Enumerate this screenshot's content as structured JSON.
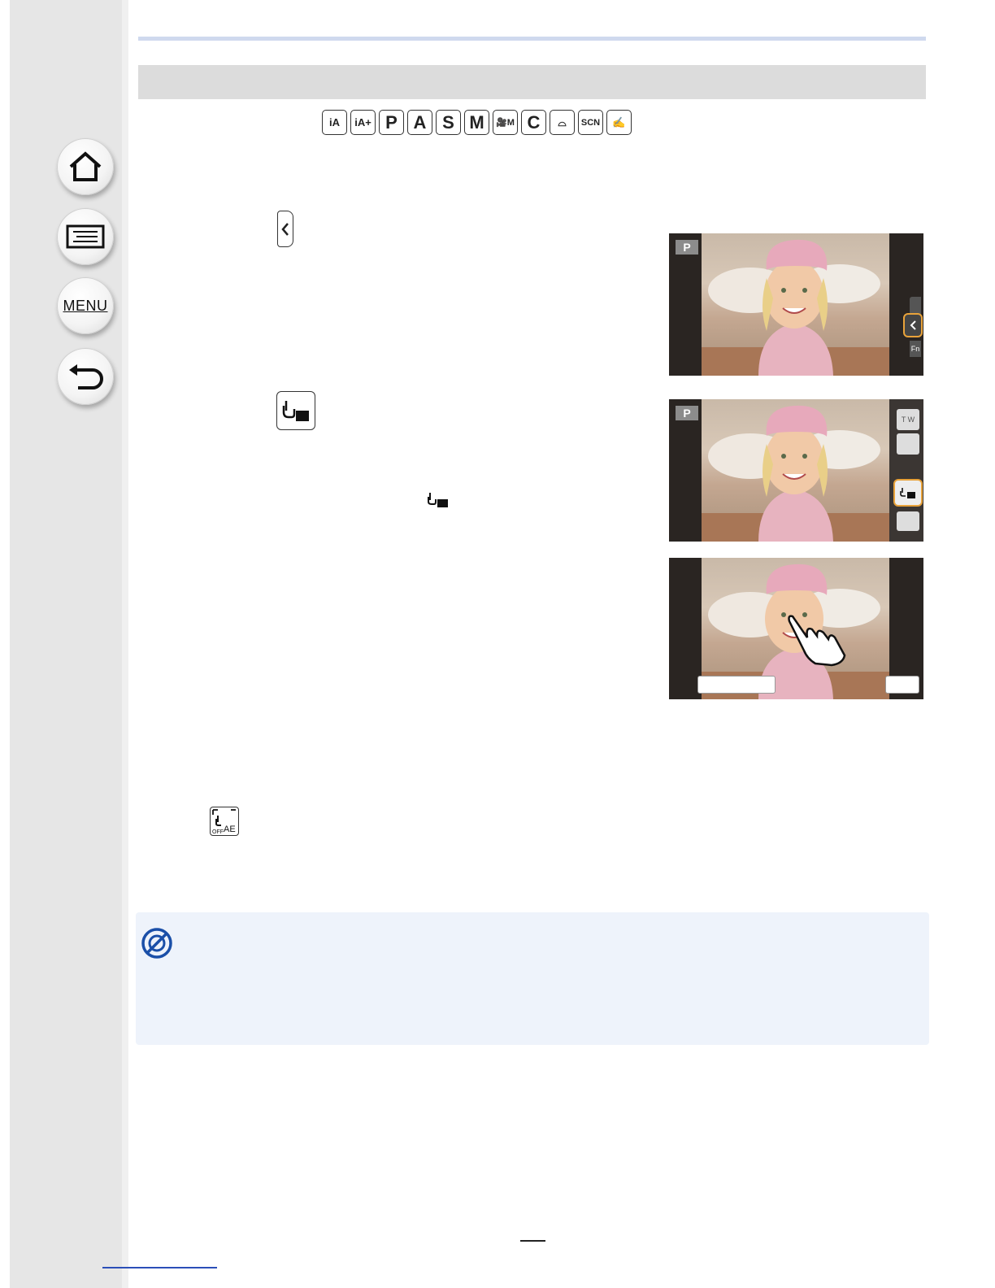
{
  "sidebar": {
    "menu_label": "MENU"
  },
  "mode_icons": [
    "iA",
    "iA+",
    "P",
    "A",
    "S",
    "M",
    "🎥M",
    "C",
    "⌓",
    "SCN",
    "✍"
  ],
  "screens": {
    "p_badge": "P",
    "fn_label": "Fn",
    "tele_wide": "T W"
  },
  "ae_icon": {
    "off": "OFF",
    "ae": "AE"
  },
  "colors": {
    "accent_blue": "#1a4fa8",
    "highlight_orange": "#e8a23a",
    "note_bg": "#eef3fb"
  }
}
